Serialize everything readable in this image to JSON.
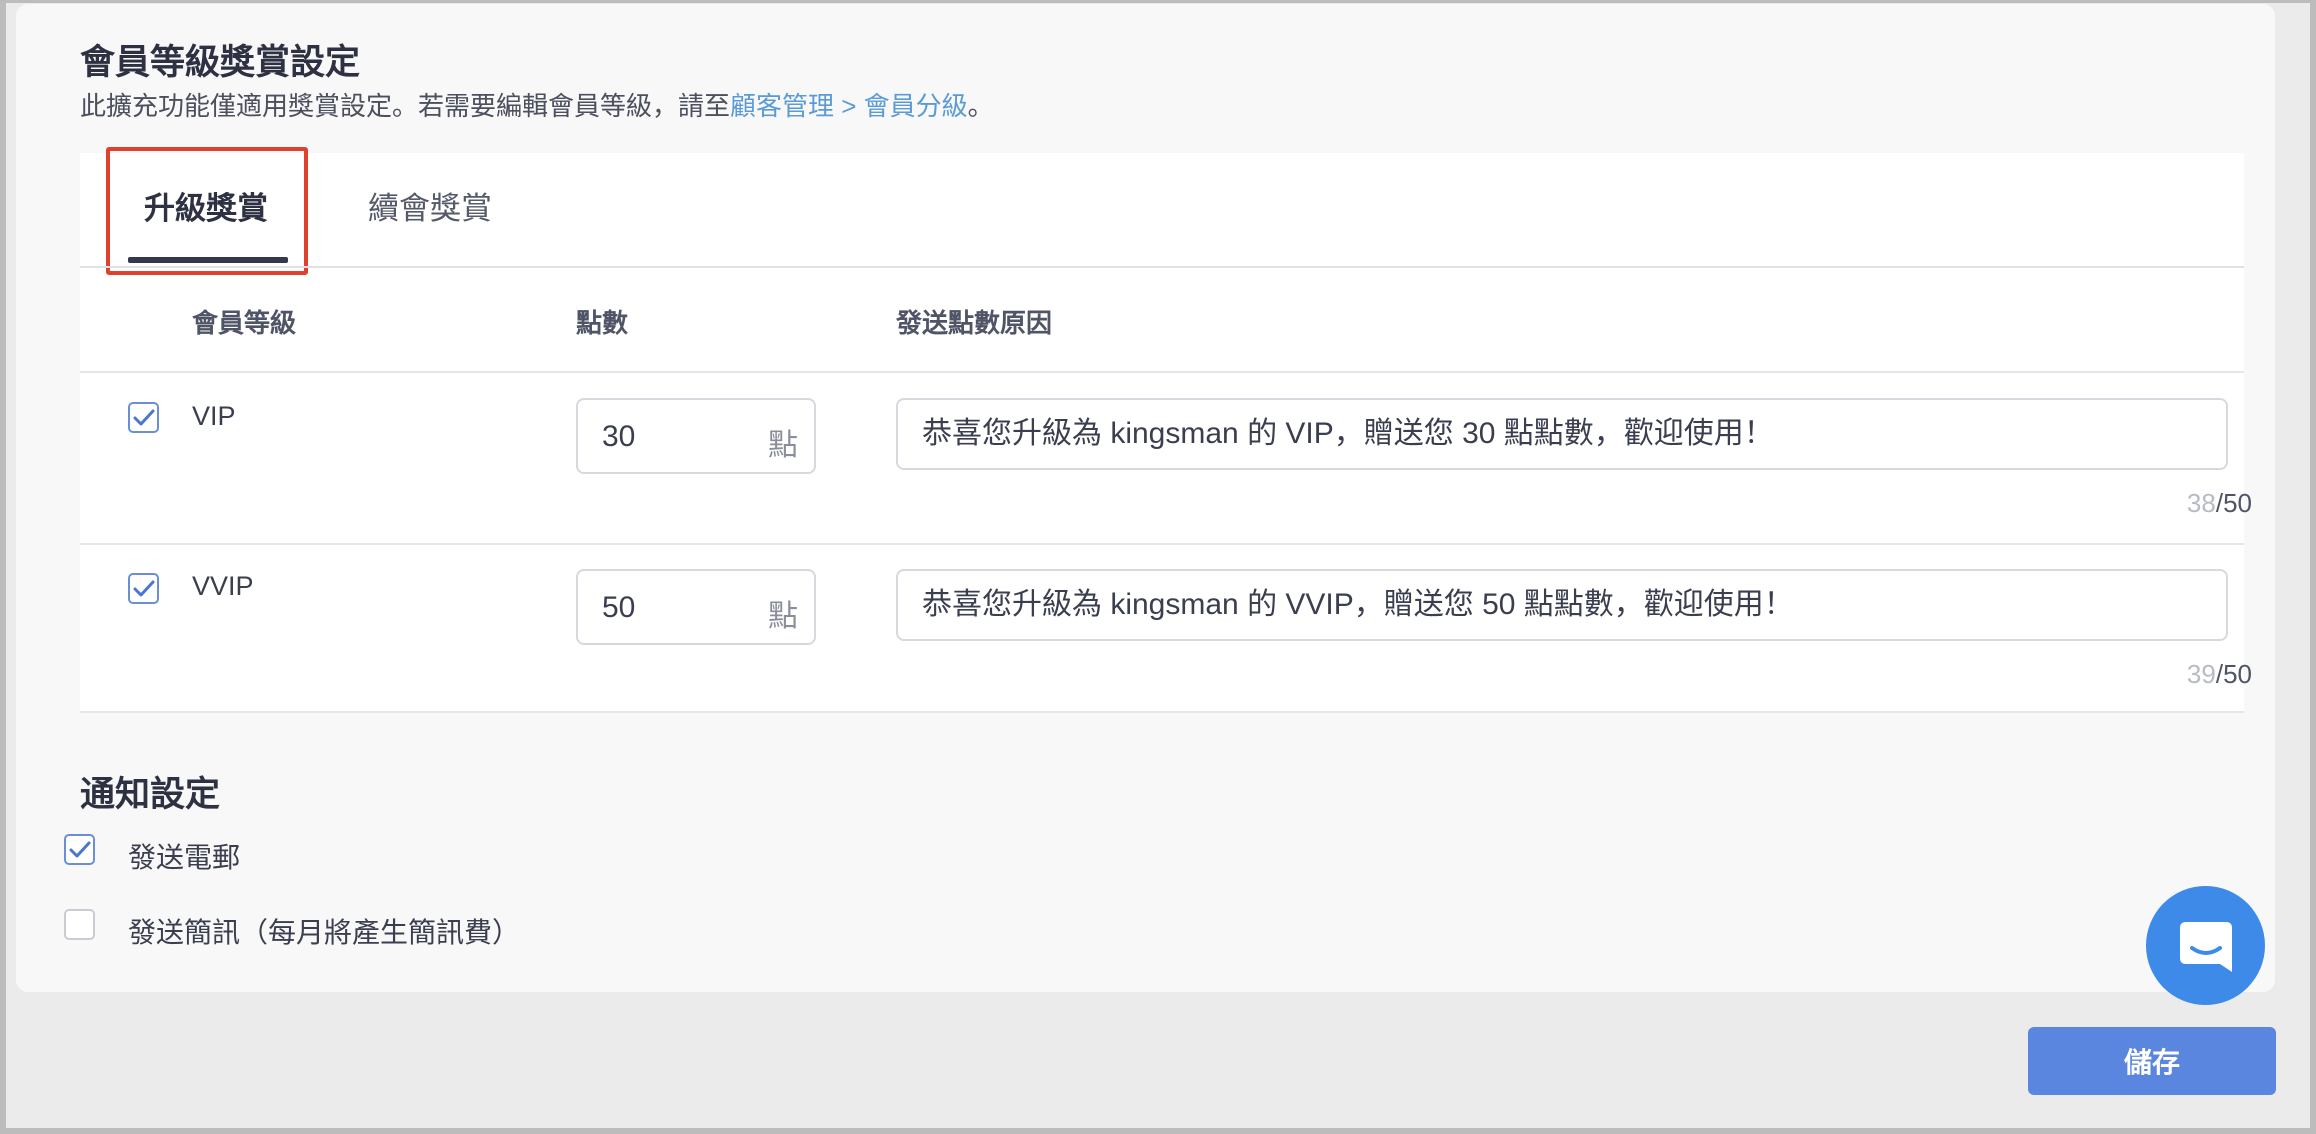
{
  "header": {
    "title": "會員等級獎賞設定",
    "desc_prefix": "此擴充功能僅適用獎賞設定。若需要編輯會員等級，請至",
    "desc_link": "顧客管理 > 會員分級",
    "desc_suffix": "。"
  },
  "tabs": [
    {
      "label": "升級獎賞",
      "active": true
    },
    {
      "label": "續會獎賞",
      "active": false
    }
  ],
  "table": {
    "headers": [
      "會員等級",
      "點數",
      "發送點數原因"
    ],
    "rows": [
      {
        "checked": true,
        "level": "VIP",
        "points": "30",
        "unit": "點",
        "reason": "恭喜您升級為 kingsman 的 VIP，贈送您 30 點點數，歡迎使用！",
        "count": "38",
        "max": "/50"
      },
      {
        "checked": true,
        "level": "VVIP",
        "points": "50",
        "unit": "點",
        "reason": "恭喜您升級為 kingsman 的 VVIP，贈送您 50 點點數，歡迎使用！",
        "count": "39",
        "max": "/50"
      }
    ]
  },
  "notify": {
    "title": "通知設定",
    "options": [
      {
        "label": "發送電郵",
        "checked": true
      },
      {
        "label": "發送簡訊（每月將產生簡訊費）",
        "checked": false
      }
    ]
  },
  "actions": {
    "save_label": "儲存"
  },
  "colors": {
    "accent": "#5b86e0",
    "link": "#5b9bd5",
    "highlight": "#e0412f",
    "chat": "#3d8ae8"
  },
  "icons": {
    "chat": "chat-bubble-icon",
    "check": "check-icon"
  }
}
